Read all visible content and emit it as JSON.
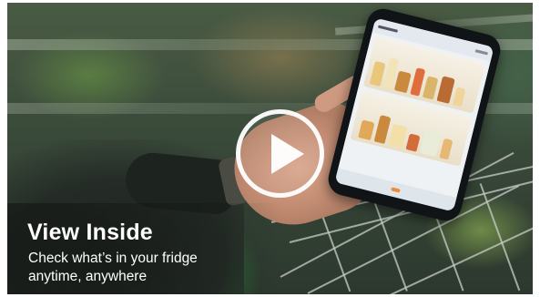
{
  "video": {
    "caption_title": "View Inside",
    "caption_lines": [
      "Check what’s in your fridge",
      "anytime, anywhere"
    ],
    "play_icon": "play-icon",
    "colors": {
      "caption_text": "#ffffff",
      "play_ring": "#ffffff",
      "app_accent": "#f08a3c"
    }
  }
}
